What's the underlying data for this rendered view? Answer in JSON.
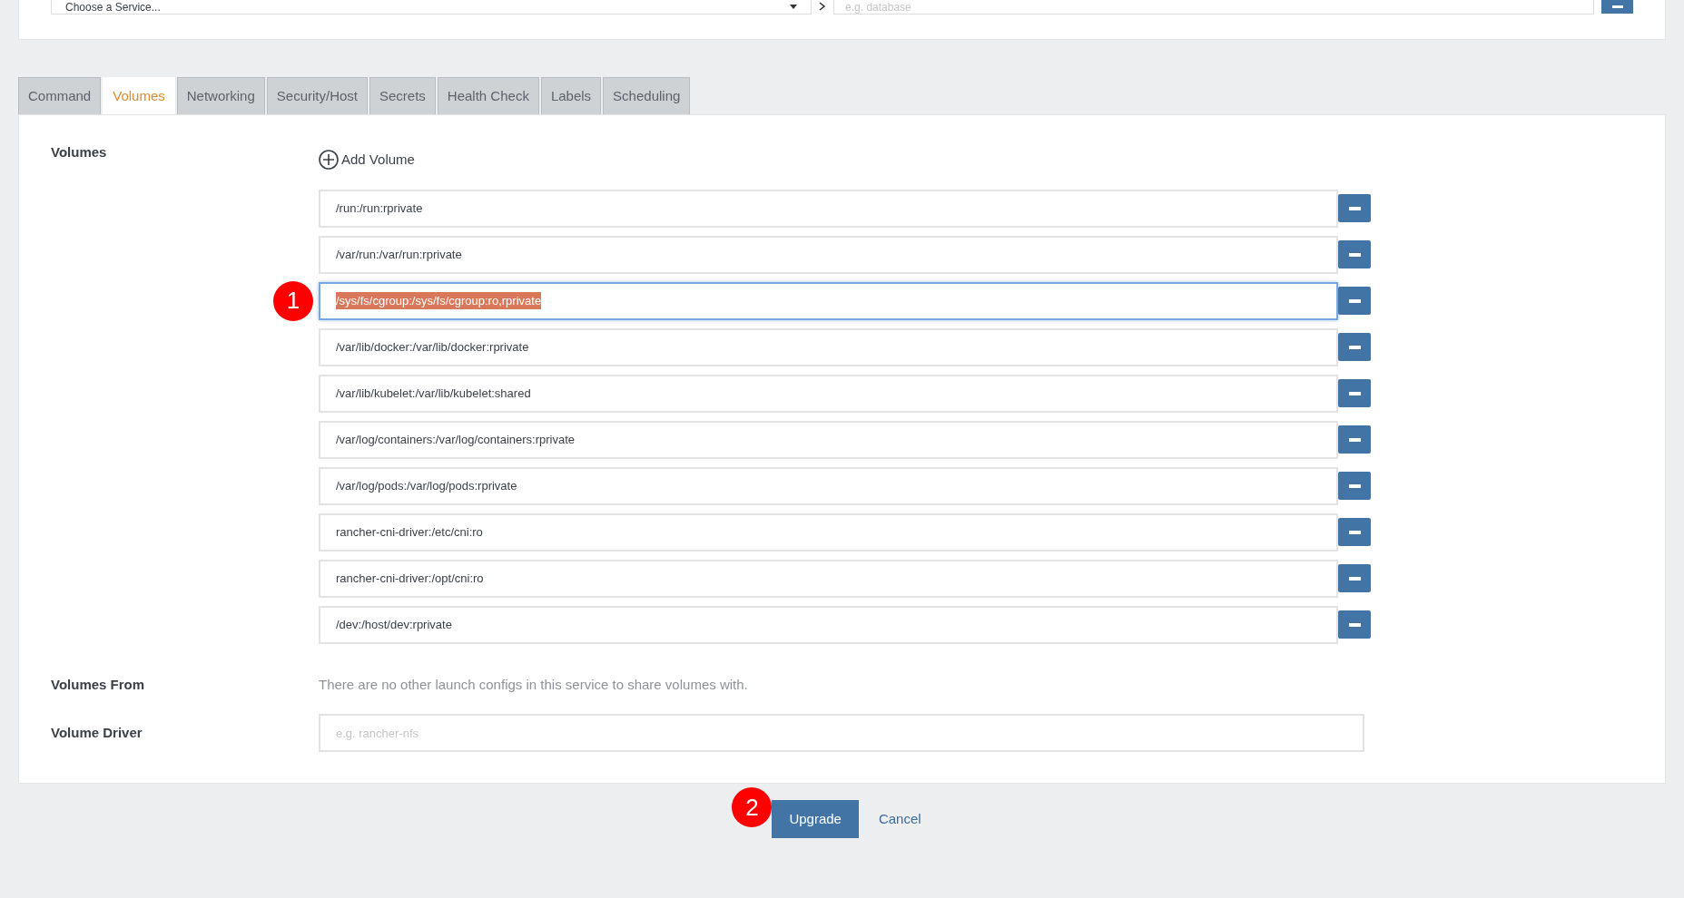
{
  "top_bar": {
    "service_select": {
      "value": "Choose a Service..."
    },
    "alias_field": {
      "placeholder": "e.g. database"
    }
  },
  "tabs": [
    {
      "label": "Command",
      "selected": false
    },
    {
      "label": "Volumes",
      "selected": true
    },
    {
      "label": "Networking",
      "selected": false
    },
    {
      "label": "Security/Host",
      "selected": false
    },
    {
      "label": "Secrets",
      "selected": false
    },
    {
      "label": "Health Check",
      "selected": false
    },
    {
      "label": "Labels",
      "selected": false
    },
    {
      "label": "Scheduling",
      "selected": false
    }
  ],
  "volumes": {
    "label": "Volumes",
    "add_button": "Add Volume",
    "marker": "1",
    "rows": [
      {
        "value": "/run:/run:rprivate",
        "focused": false
      },
      {
        "value": "/var/run:/var/run:rprivate",
        "focused": false
      },
      {
        "value": "/sys/fs/cgroup:/sys/fs/cgroup:ro,rprivate",
        "focused": true
      },
      {
        "value": "/var/lib/docker:/var/lib/docker:rprivate",
        "focused": false
      },
      {
        "value": "/var/lib/kubelet:/var/lib/kubelet:shared",
        "focused": false
      },
      {
        "value": "/var/log/containers:/var/log/containers:rprivate",
        "focused": false
      },
      {
        "value": "/var/log/pods:/var/log/pods:rprivate",
        "focused": false
      },
      {
        "value": "rancher-cni-driver:/etc/cni:ro",
        "focused": false
      },
      {
        "value": "rancher-cni-driver:/opt/cni:ro",
        "focused": false
      },
      {
        "value": "/dev:/host/dev:rprivate",
        "focused": false
      }
    ]
  },
  "volumes_from": {
    "label": "Volumes From",
    "text": "There are no other launch configs in this service to share volumes with."
  },
  "volume_driver": {
    "label": "Volume Driver",
    "placeholder": "e.g. rancher-nfs"
  },
  "footer": {
    "marker": "2",
    "primary": "Upgrade",
    "cancel": "Cancel"
  }
}
